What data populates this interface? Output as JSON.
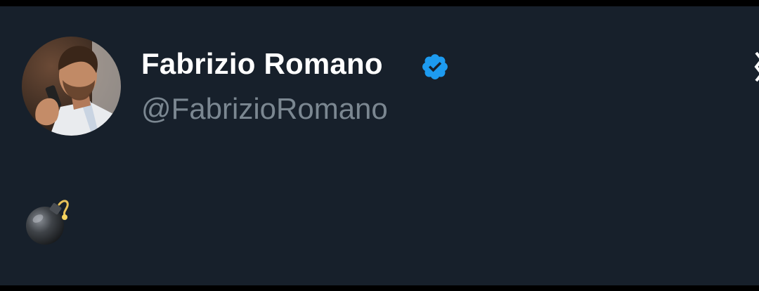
{
  "tweet": {
    "author": {
      "display_name": "Fabrizio Romano",
      "handle": "@FabrizioRomano",
      "verified": true,
      "avatar_icon": "profile-photo"
    },
    "body_emoji": "bomb-emoji",
    "platform_icon": "x-logo-icon"
  },
  "colors": {
    "background": "#17202b",
    "name": "#ffffff",
    "handle": "#7b8791",
    "verified_badge": "#1d9bf0"
  }
}
